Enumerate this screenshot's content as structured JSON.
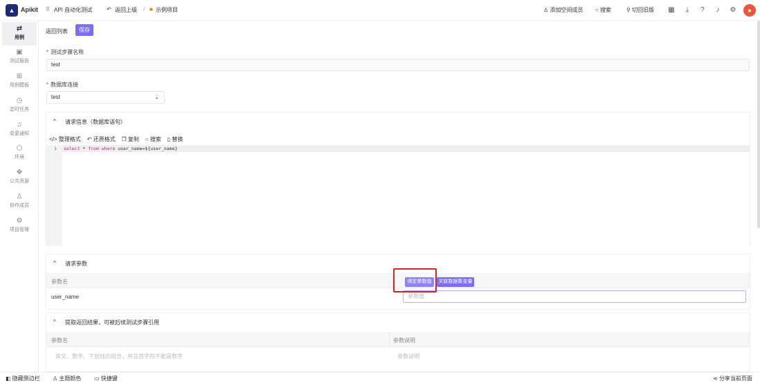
{
  "topbar": {
    "logo": "Apikit",
    "app": "API 自动化测试",
    "back": "返回上级",
    "sep": "/",
    "project": "示例项目",
    "add_member": "添加空间成员",
    "search": "搜索",
    "switch_old": "切回旧版",
    "avatar": "头像"
  },
  "sidebar": {
    "items": [
      {
        "label": "用例",
        "icon": "⇄"
      },
      {
        "label": "测试报告",
        "icon": "▣"
      },
      {
        "label": "用例模板",
        "icon": "⊞"
      },
      {
        "label": "定时任务",
        "icon": "◷"
      },
      {
        "label": "变更通知",
        "icon": "♫"
      },
      {
        "label": "环境",
        "icon": "⬡"
      },
      {
        "label": "公共资源",
        "icon": "✥"
      },
      {
        "label": "协作成员",
        "icon": "♙"
      },
      {
        "label": "项目管理",
        "icon": "⚙"
      }
    ]
  },
  "actions": {
    "back_list": "返回列表",
    "save": "保存"
  },
  "form": {
    "step_name_label": "测试步骤名称",
    "step_name_value": "test",
    "db_label": "数据库连接",
    "db_value": "test"
  },
  "request": {
    "title": "请求信息（数据库语句）",
    "toolbar": [
      "整理格式",
      "还原格式",
      "复制",
      "搜索",
      "替换"
    ],
    "line_no": "1",
    "code": {
      "kw1": "select",
      "star": " * ",
      "kw2": "from",
      "kw3": " where ",
      "rest": "user_name=${user_name}"
    }
  },
  "params": {
    "title": "请求参数",
    "col_name": "参数名",
    "bind_btn": "绑定参数值",
    "link_btn": "关联数据集变量",
    "row_name": "user_name",
    "value_placeholder": "参数值"
  },
  "extract": {
    "title": "提取返回结果，可被后续测试步骤引用",
    "col_name": "参数名",
    "col_desc": "参数说明",
    "name_placeholder": "英文、数字、下划线的组合，并且首字符不能是数字",
    "desc_placeholder": "参数说明"
  },
  "bottombar": {
    "hide_sidebar": "隐藏侧边栏",
    "theme": "主题颜色",
    "shortcuts": "快捷键",
    "share": "分享当前页面"
  },
  "colors": {
    "accent": "#7b6ef6",
    "highlight": "#e02020",
    "logo": "#1e2a78"
  }
}
